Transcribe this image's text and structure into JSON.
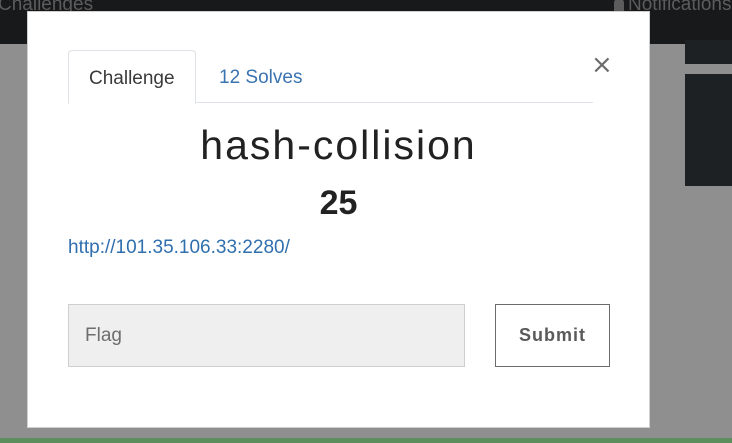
{
  "background": {
    "nav_left": "Challenges",
    "nav_right": "Notifications"
  },
  "modal": {
    "close_symbol": "×",
    "tabs": [
      {
        "label": "Challenge",
        "active": true
      },
      {
        "label": "12 Solves",
        "active": false
      }
    ],
    "challenge": {
      "name": "hash-collision",
      "value": "25",
      "link": "http://101.35.106.33:2280/"
    },
    "flag_input": {
      "placeholder": "Flag",
      "value": ""
    },
    "submit_label": "Submit"
  },
  "colors": {
    "link": "#3a74b0",
    "overlay": "#8f8f8f",
    "topbar": "#17191b"
  },
  "icons": {
    "close": "close-icon",
    "notifications": "bell-icon"
  }
}
